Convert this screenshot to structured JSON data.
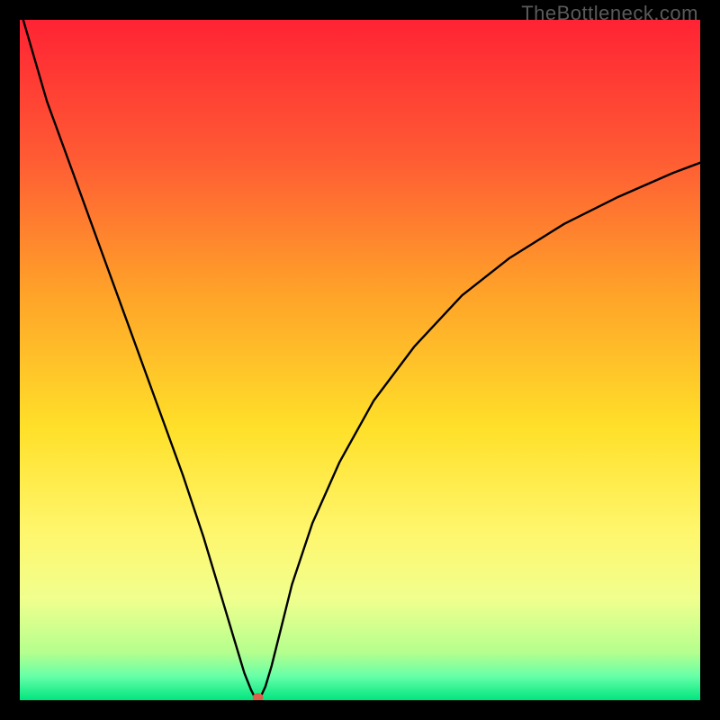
{
  "watermark": "TheBottleneck.com",
  "chart_data": {
    "type": "line",
    "title": "",
    "xlabel": "",
    "ylabel": "",
    "xlim": [
      0,
      100
    ],
    "ylim": [
      0,
      100
    ],
    "grid": false,
    "legend": false,
    "background_gradient": {
      "stops": [
        {
          "pos": 0.0,
          "color": "#ff2334"
        },
        {
          "pos": 0.2,
          "color": "#ff5a34"
        },
        {
          "pos": 0.4,
          "color": "#ffa229"
        },
        {
          "pos": 0.6,
          "color": "#ffe029"
        },
        {
          "pos": 0.75,
          "color": "#fff66c"
        },
        {
          "pos": 0.85,
          "color": "#f1ff8e"
        },
        {
          "pos": 0.93,
          "color": "#b4ff8e"
        },
        {
          "pos": 0.965,
          "color": "#66ffa8"
        },
        {
          "pos": 1.0,
          "color": "#00e57e"
        }
      ]
    },
    "series": [
      {
        "name": "bottleneck-curve",
        "color": "#000000",
        "x": [
          0.5,
          4,
          8,
          12,
          16,
          20,
          24,
          27,
          30,
          31.5,
          33,
          34.0,
          34.6,
          35.3,
          36.1,
          37.0,
          38.5,
          40,
          43,
          47,
          52,
          58,
          65,
          72,
          80,
          88,
          96,
          100
        ],
        "values": [
          100,
          88,
          77,
          66,
          55,
          44,
          33,
          24,
          14,
          9.0,
          4.0,
          1.5,
          0.3,
          0.3,
          2.0,
          5.0,
          11.0,
          17,
          26,
          35,
          44,
          52,
          59.5,
          65,
          70,
          74,
          77.5,
          79
        ]
      }
    ],
    "marker": {
      "name": "optimal-point",
      "x": 35.0,
      "y": 0.4,
      "rx": 6,
      "ry": 5,
      "color": "#d9624c"
    }
  }
}
